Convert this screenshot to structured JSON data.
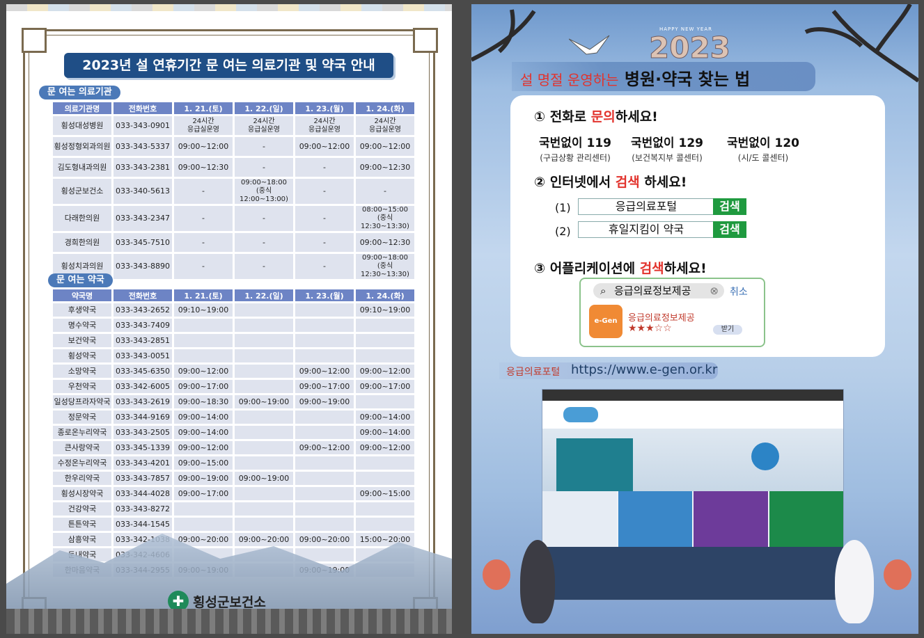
{
  "left": {
    "title": "2023년 설 연휴기간 문 여는 의료기관 및 약국 안내",
    "clinics": {
      "section": "문 여는 의료기관",
      "headers": [
        "의료기관명",
        "전화번호",
        "1. 21.(토)",
        "1. 22.(일)",
        "1. 23.(월)",
        "1. 24.(화)"
      ],
      "rows": [
        [
          "횡성대성병원",
          "033-343-0901",
          "24시간\n응급실운영",
          "24시간\n응급실운영",
          "24시간\n응급실운영",
          "24시간\n응급실운영"
        ],
        [
          "횡성정형외과의원",
          "033-343-5337",
          "09:00~12:00",
          "-",
          "09:00~12:00",
          "09:00~12:00"
        ],
        [
          "김도형내과의원",
          "033-343-2381",
          "09:00~12:30",
          "-",
          "-",
          "09:00~12:30"
        ],
        [
          "횡성군보건소",
          "033-340-5613",
          "-",
          "09:00~18:00\n(중식12:00~13:00)",
          "-",
          "-"
        ],
        [
          "다래한의원",
          "033-343-2347",
          "-",
          "-",
          "-",
          "08:00~15:00\n(중식12:30~13:30)"
        ],
        [
          "경희한의원",
          "033-345-7510",
          "-",
          "-",
          "-",
          "09:00~12:30"
        ],
        [
          "횡성치과의원",
          "033-343-8890",
          "-",
          "-",
          "-",
          "09:00~18:00\n(중식12:30~13:30)"
        ]
      ]
    },
    "pharmacies": {
      "section": "문 여는 약국",
      "headers": [
        "약국명",
        "전화번호",
        "1. 21.(토)",
        "1. 22.(일)",
        "1. 23.(월)",
        "1. 24.(화)"
      ],
      "rows": [
        [
          "후생약국",
          "033-343-2652",
          "09:10~19:00",
          "",
          "",
          "09:10~19:00"
        ],
        [
          "명수약국",
          "033-343-7409",
          "",
          "",
          "",
          ""
        ],
        [
          "보건약국",
          "033-343-2851",
          "",
          "",
          "",
          ""
        ],
        [
          "횡성약국",
          "033-343-0051",
          "",
          "",
          "",
          ""
        ],
        [
          "소망약국",
          "033-345-6350",
          "09:00~12:00",
          "",
          "09:00~12:00",
          "09:00~12:00"
        ],
        [
          "우천약국",
          "033-342-6005",
          "09:00~17:00",
          "",
          "09:00~17:00",
          "09:00~17:00"
        ],
        [
          "일성당프라자약국",
          "033-343-2619",
          "09:00~18:30",
          "09:00~19:00",
          "09:00~19:00",
          ""
        ],
        [
          "정문약국",
          "033-344-9169",
          "09:00~14:00",
          "",
          "",
          "09:00~14:00"
        ],
        [
          "종로온누리약국",
          "033-343-2505",
          "09:00~14:00",
          "",
          "",
          "09:00~14:00"
        ],
        [
          "큰사랑약국",
          "033-345-1339",
          "09:00~12:00",
          "",
          "09:00~12:00",
          "09:00~12:00"
        ],
        [
          "수정온누리약국",
          "033-343-4201",
          "09:00~15:00",
          "",
          "",
          ""
        ],
        [
          "한우리약국",
          "033-343-7857",
          "09:00~19:00",
          "09:00~19:00",
          "",
          ""
        ],
        [
          "횡성시장약국",
          "033-344-4028",
          "09:00~17:00",
          "",
          "",
          "09:00~15:00"
        ],
        [
          "건강약국",
          "033-343-8272",
          "",
          "",
          "",
          ""
        ],
        [
          "튼튼약국",
          "033-344-1545",
          "",
          "",
          "",
          ""
        ],
        [
          "삼흥약국",
          "033-342-1038",
          "09:00~20:00",
          "09:00~20:00",
          "09:00~20:00",
          "15:00~20:00"
        ],
        [
          "둔내약국",
          "033-342-4606",
          "",
          "",
          "",
          ""
        ],
        [
          "한마음약국",
          "033-344-2955",
          "09:00~19:00",
          "",
          "09:00~19:00",
          ""
        ]
      ]
    },
    "footer": "횡성군보건소"
  },
  "right": {
    "happy_new_year": "HAPPY NEW YEAR",
    "year": "2023",
    "banner_small": "설 명절 운영하는",
    "banner_big": "병원·약국 찾는 법",
    "step1": {
      "pre": "① 전화로 ",
      "hl": "문의",
      "post": "하세요!"
    },
    "hotlines": [
      {
        "num": "국번없이 119",
        "desc": "(구급상황 관리센터)"
      },
      {
        "num": "국번없이 129",
        "desc": "(보건복지부 콜센터)"
      },
      {
        "num": "국번없이 120",
        "desc": "(시/도 콜센터)"
      }
    ],
    "step2": {
      "pre": "② 인터넷에서 ",
      "hl": "검색",
      "post": " 하세요!"
    },
    "searches": [
      {
        "label": "(1)",
        "query": "응급의료포털",
        "button": "검색"
      },
      {
        "label": "(2)",
        "query": "휴일지킴이 약국",
        "button": "검색"
      }
    ],
    "step3": {
      "pre": "③ 어플리케이션에 ",
      "hl": "검색",
      "post": "하세요!"
    },
    "app": {
      "search_value": "응급의료정보제공",
      "cancel": "취소",
      "name": "응급의료정보제공",
      "rating": "★★★☆☆",
      "action": "받기",
      "icon_text": "e-Gen"
    },
    "portal_label": "응급의료포털",
    "portal_url": "https://www.e-gen.or.kr"
  },
  "colors": {
    "navy": "#1f4e86",
    "table_header": "#6d84c5",
    "search_green": "#1f9a3f",
    "highlight_red": "#e2332d"
  }
}
